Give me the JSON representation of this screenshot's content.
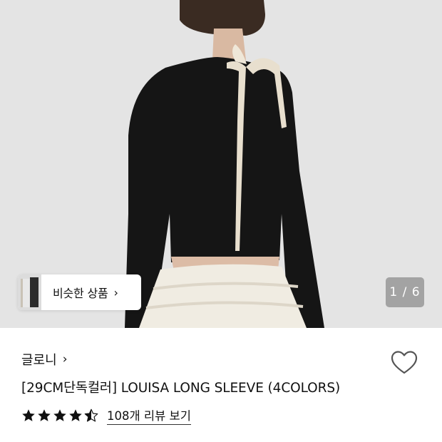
{
  "hero": {
    "image_alt": "Model wearing black long sleeve top with ivory ribbon ties and ruffled skirt",
    "page_indicator": "1 / 6"
  },
  "similar": {
    "label": "비슷한 상품",
    "chevron": "›",
    "icon": "chevron-right-icon"
  },
  "product": {
    "brand": "글로니",
    "brand_chevron": "›",
    "title": "[29CM단독컬러] LOUISA LONG SLEEVE (4COLORS)",
    "rating": 4.5,
    "rating_max": 5,
    "review_link": "108개 리뷰 보기",
    "wishlist_icon": "heart-outline-icon"
  },
  "colors": {
    "text": "#111111",
    "background": "#ffffff",
    "hero_bg": "#e4e4e4",
    "indicator_bg": "#6e6e6e"
  }
}
